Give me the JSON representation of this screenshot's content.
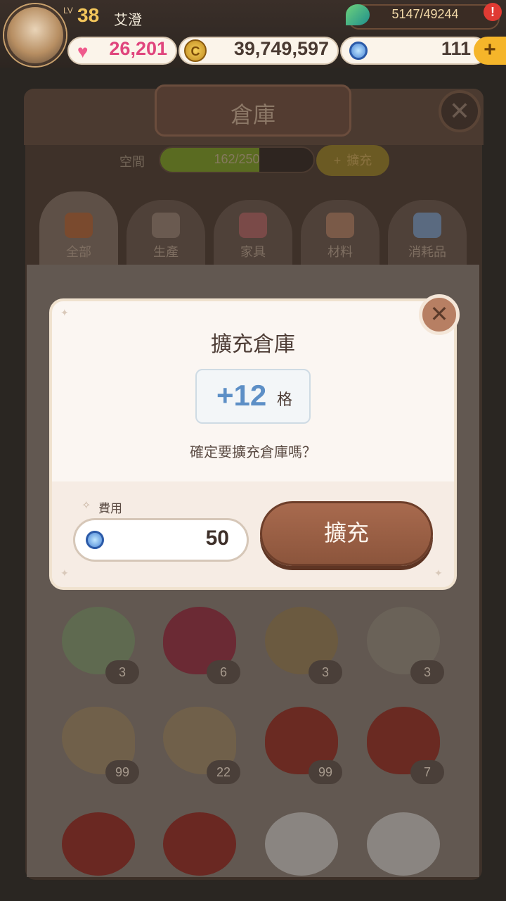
{
  "player": {
    "lv_prefix": "LV",
    "level": "38",
    "name": "艾澄"
  },
  "exp": {
    "text": "5147/49244",
    "progress": 0.1047
  },
  "resources": {
    "hearts": "26,201",
    "coins": "39,749,597",
    "coin_symbol": "C",
    "gems": "111",
    "plus": "+"
  },
  "alert_symbol": "!",
  "warehouse": {
    "title": "倉庫",
    "space_label": "空間",
    "space_text": "162/250",
    "space_progress": 0.648,
    "expand_label": "擴充",
    "expand_plus": "+",
    "close_symbol": "✕",
    "tabs": [
      {
        "label": "全部",
        "icon": "grid-icon",
        "color": "#7a4a2e"
      },
      {
        "label": "生產",
        "icon": "hammer-icon",
        "color": "#6a5a50"
      },
      {
        "label": "家具",
        "icon": "sofa-icon",
        "color": "#7a4a48"
      },
      {
        "label": "材料",
        "icon": "wood-log-icon",
        "color": "#7a5a48"
      },
      {
        "label": "消耗品",
        "icon": "potion-icon",
        "color": "#5a6a80"
      }
    ],
    "items": [
      {
        "name": "salad-dish",
        "count": "3"
      },
      {
        "name": "cherry-cocktail",
        "count": "6"
      },
      {
        "name": "caviar-tin",
        "count": "3"
      },
      {
        "name": "berry-tart",
        "count": "3"
      },
      {
        "name": "wheat",
        "count": "99"
      },
      {
        "name": "wheat",
        "count": "22"
      },
      {
        "name": "strawberry",
        "count": "99"
      },
      {
        "name": "strawberry",
        "count": "7"
      },
      {
        "name": "tomato",
        "count": ""
      },
      {
        "name": "tomato",
        "count": ""
      },
      {
        "name": "cotton",
        "count": ""
      },
      {
        "name": "cotton",
        "count": ""
      }
    ]
  },
  "dialog": {
    "title": "擴充倉庫",
    "amount": "+12",
    "unit": "格",
    "message": "確定要擴充倉庫嗎？",
    "cost_label": "費用",
    "cost_value": "50",
    "confirm_label": "擴充",
    "close_symbol": "✕"
  },
  "colors": {
    "accent_gem": "#4b86d6",
    "heart": "#ef5a8c",
    "coin": "#e8b83a",
    "confirm_button": "#9b5f44"
  }
}
